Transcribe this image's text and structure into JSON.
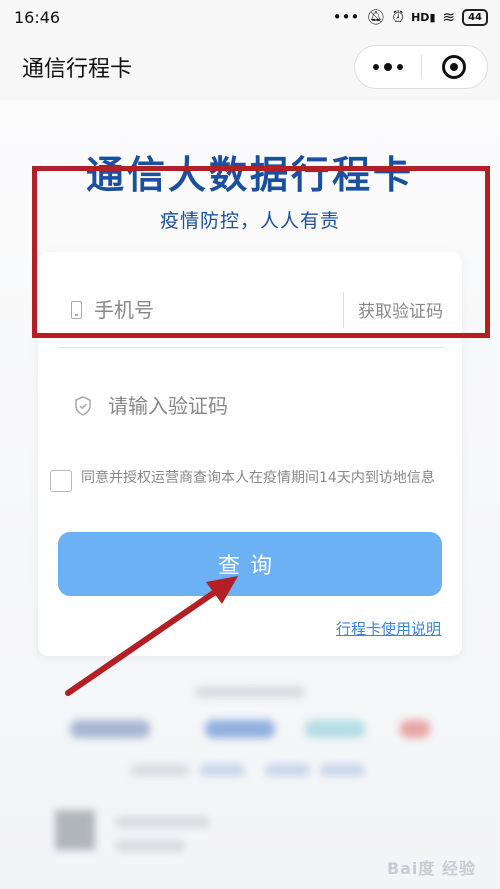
{
  "status_bar": {
    "time": "16:46",
    "icons": [
      "more-icon",
      "mute-icon",
      "alarm-icon",
      "hd-signal-icon",
      "wifi-icon",
      "battery-icon"
    ],
    "battery": "44",
    "hd_label": "HD"
  },
  "nav": {
    "title": "通信行程卡",
    "more_icon": "more-dots-icon",
    "close_icon": "target-close-icon"
  },
  "main": {
    "brand_title": "通信大数据行程卡",
    "slogan": "疫情防控，人人有责",
    "phone": {
      "placeholder": "手机号",
      "value": "",
      "icon": "phone-icon"
    },
    "get_code_label": "获取验证码",
    "code": {
      "placeholder": "请输入验证码",
      "value": "",
      "icon": "shield-icon"
    },
    "consent_text": "同意并授权运营商查询本人在疫情期间14天内到访地信息",
    "consent_checked": false,
    "query_button": "查询",
    "help_link": "行程卡使用说明"
  },
  "watermark": "Bai度 经验",
  "colors": {
    "brand_blue": "#1b4fa0",
    "button_blue": "#6cb1f4",
    "link_blue": "#3b84d6",
    "annotation_red": "#b21f24"
  }
}
